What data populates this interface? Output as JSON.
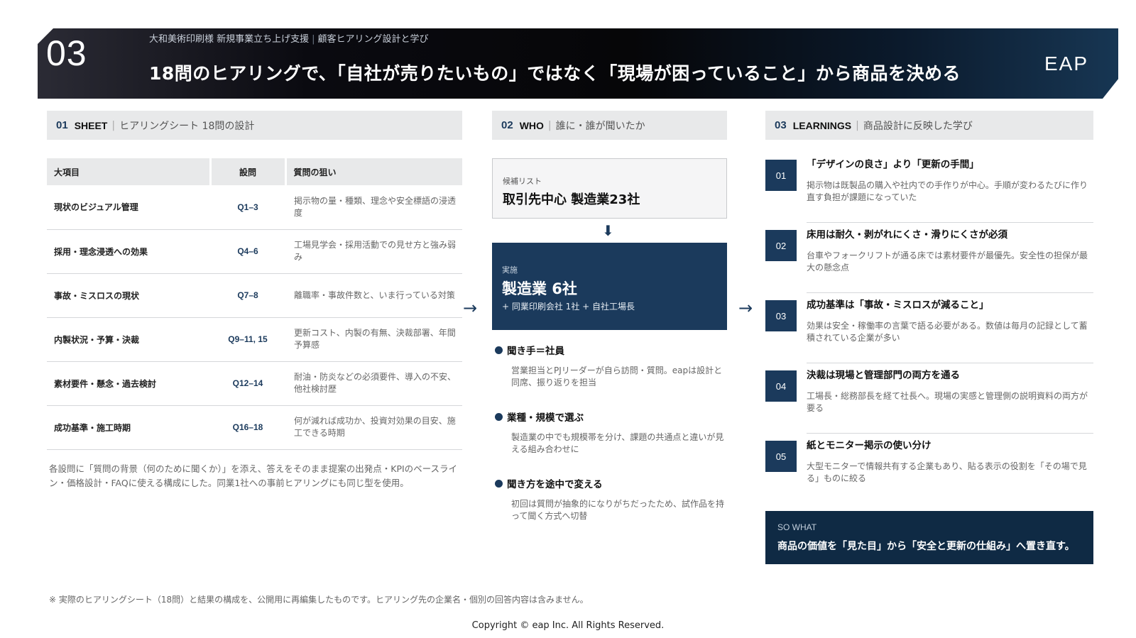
{
  "header": {
    "number": "03",
    "client": "大和美術印刷様 新規事業立ち上げ支援",
    "topic": "顧客ヒアリング設計と学び",
    "title": "18問のヒアリングで、「自社が売りたいもの」ではなく「現場が困っていること」から商品を決める",
    "logo": "EAP"
  },
  "sheet": {
    "num": "01",
    "key": "SHEET",
    "label": "ヒアリングシート 18問の設計",
    "headers": [
      "大項目",
      "設問",
      "質問の狙い"
    ],
    "rows": [
      {
        "item": "現状のビジュアル管理",
        "q": "Q1–3",
        "aim": "掲示物の量・種類、理念や安全標語の浸透度"
      },
      {
        "item": "採用・理念浸透への効果",
        "q": "Q4–6",
        "aim": "工場見学会・採用活動での見せ方と強み弱み"
      },
      {
        "item": "事故・ミスロスの現状",
        "q": "Q7–8",
        "aim": "離職率・事故件数と、いま行っている対策"
      },
      {
        "item": "内製状況・予算・決裁",
        "q": "Q9–11, 15",
        "aim": "更新コスト、内製の有無、決裁部署、年間予算感"
      },
      {
        "item": "素材要件・懸念・過去検討",
        "q": "Q12–14",
        "aim": "耐油・防炎などの必須要件、導入の不安、他社検討歴"
      },
      {
        "item": "成功基準・施工時期",
        "q": "Q16–18",
        "aim": "何が減れば成功か、投資対効果の目安、施工できる時期"
      }
    ],
    "note": "各設問に「質問の背景（何のために聞くか）」を添え、答えをそのまま提案の出発点・KPIのベースライン・価格設計・FAQに使える構成にした。同業1社への事前ヒアリングにも同じ型を使用。"
  },
  "who": {
    "num": "02",
    "key": "WHO",
    "label": "誰に・誰が聞いたか",
    "candidate_caption": "候補リスト",
    "candidate_value": "取引先中心 製造業23社",
    "impl_caption": "実施",
    "impl_value": "製造業 6社",
    "impl_extra": "+ 同業印刷会社 1社 + 自社工場長",
    "points": [
      {
        "title": "聞き手＝社員",
        "desc": "営業担当とPJリーダーが自ら訪問・質問。eapは設計と同席、振り返りを担当"
      },
      {
        "title": "業種・規模で選ぶ",
        "desc": "製造業の中でも規模帯を分け、課題の共通点と違いが見える組み合わせに"
      },
      {
        "title": "聞き方を途中で変える",
        "desc": "初回は質問が抽象的になりがちだったため、試作品を持って聞く方式へ切替"
      }
    ]
  },
  "learnings": {
    "num": "03",
    "key": "LEARNINGS",
    "label": "商品設計に反映した学び",
    "items": [
      {
        "no": "01",
        "title": "「デザインの良さ」より「更新の手間」",
        "desc": "掲示物は既製品の購入や社内での手作りが中心。手順が変わるたびに作り直す負担が課題になっていた"
      },
      {
        "no": "02",
        "title": "床用は耐久・剥がれにくさ・滑りにくさが必須",
        "desc": "台車やフォークリフトが通る床では素材要件が最優先。安全性の担保が最大の懸念点"
      },
      {
        "no": "03",
        "title": "成功基準は「事故・ミスロスが減ること」",
        "desc": "効果は安全・稼働率の言葉で語る必要がある。数値は毎月の記録として蓄積されている企業が多い"
      },
      {
        "no": "04",
        "title": "決裁は現場と管理部門の両方を通る",
        "desc": "工場長・総務部長を経て社長へ。現場の実感と管理側の説明資料の両方が要る"
      },
      {
        "no": "05",
        "title": "紙とモニター掲示の使い分け",
        "desc": "大型モニターで情報共有する企業もあり、貼る表示の役割を「その場で見る」ものに絞る"
      }
    ],
    "sowhat_caption": "SO WHAT",
    "sowhat_text": "商品の価値を「見た目」から「安全と更新の仕組み」へ置き直す。"
  },
  "arrows": {
    "right": "→",
    "down": "⬇"
  },
  "footnote": "※ 実際のヒアリングシート（18問）と結果の構成を、公開用に再編集したものです。ヒアリング先の企業名・個別の回答内容は含みません。",
  "copyright": "Copyright © eap Inc. All Rights Reserved.",
  "colors": {
    "navy": "#1b3a5c",
    "dark_navy": "#0f2a44",
    "label_bg": "#e8e9ea"
  }
}
